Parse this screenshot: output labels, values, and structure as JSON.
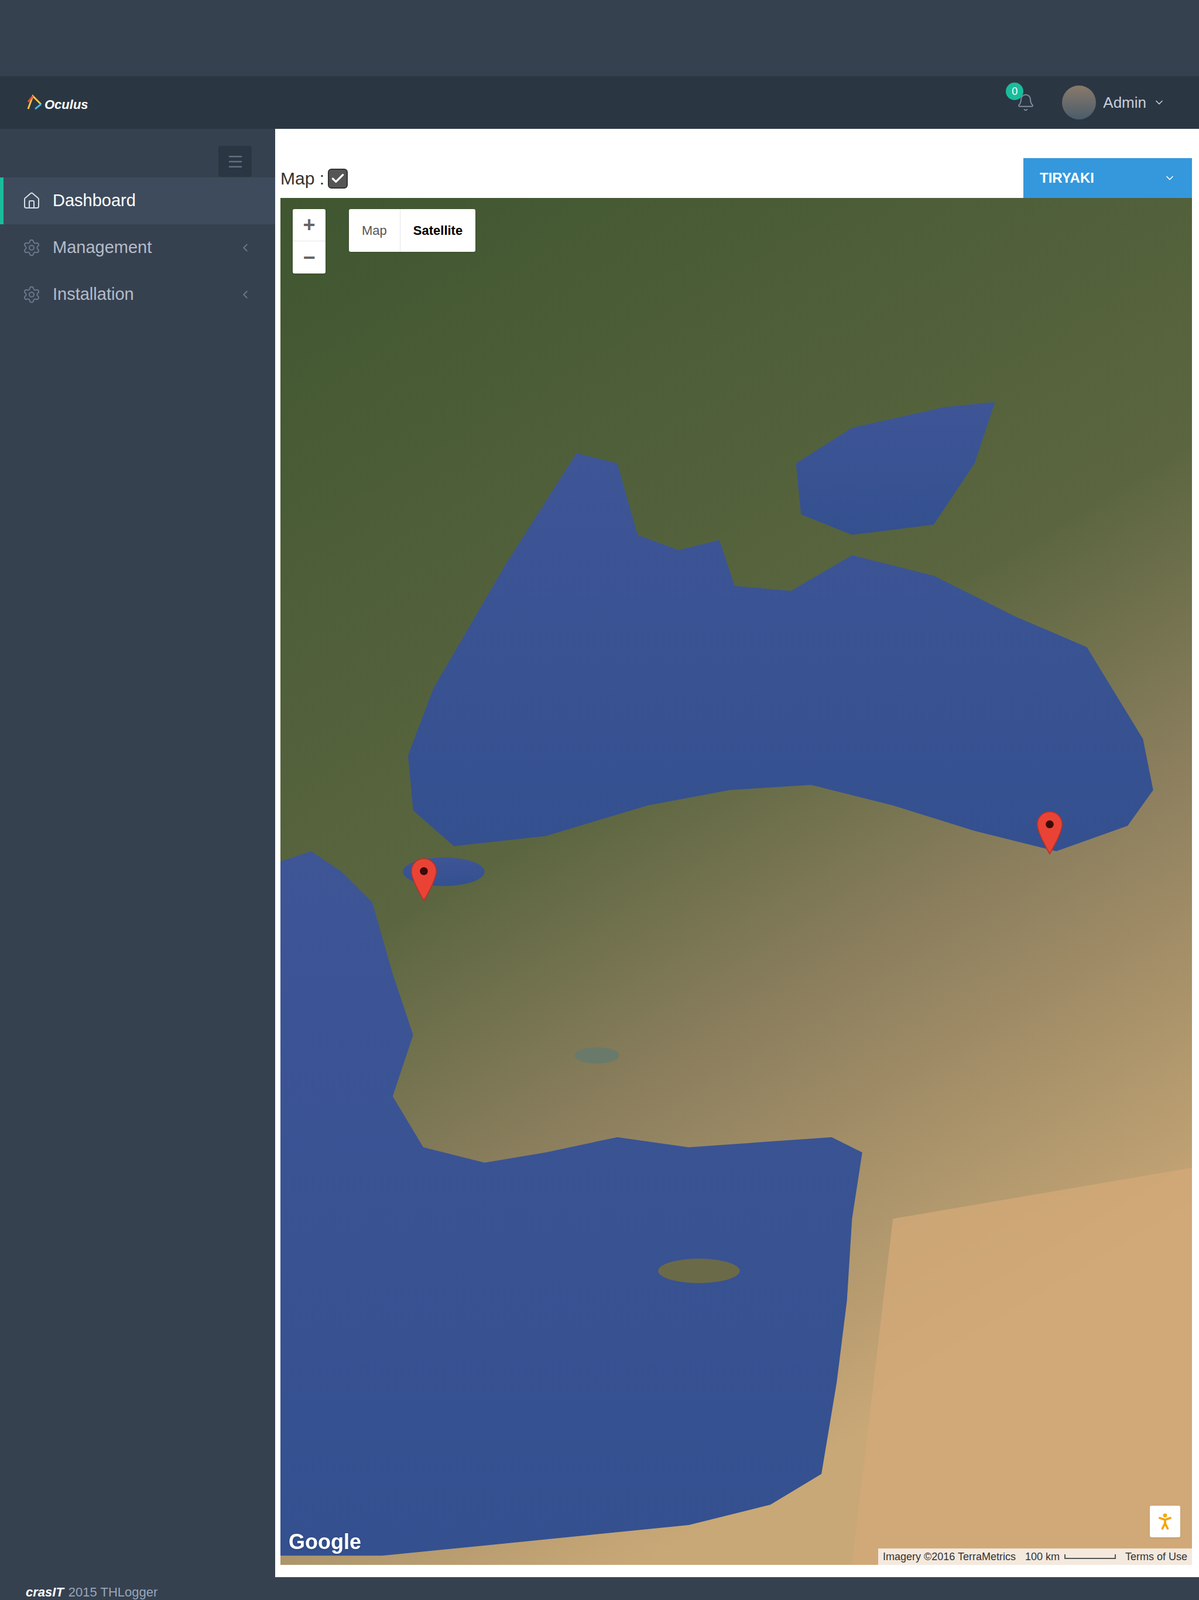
{
  "header": {
    "logo": "Oculus",
    "notifications": "0",
    "user": "Admin"
  },
  "sidebar": {
    "items": [
      {
        "label": "Dashboard",
        "selected": true
      },
      {
        "label": "Management",
        "selected": false
      },
      {
        "label": "Installation",
        "selected": false
      }
    ]
  },
  "map_toggle": {
    "label": "Map :",
    "checked": true
  },
  "site_select": {
    "value": "TIRYAKI"
  },
  "map": {
    "zoom_in": "+",
    "zoom_out": "−",
    "types": [
      {
        "label": "Map",
        "selected": false
      },
      {
        "label": "Satellite",
        "selected": true
      }
    ],
    "pins": [
      {
        "lat": 40.2,
        "lon": 29.0
      },
      {
        "lat": 41.0,
        "lon": 40.5
      }
    ],
    "brand": "Google",
    "attribution": "Imagery ©2016 TerraMetrics",
    "scale": "100 km",
    "terms": "Terms of Use"
  },
  "footer": {
    "logo": "crasIT",
    "text": "2015 THLogger"
  }
}
